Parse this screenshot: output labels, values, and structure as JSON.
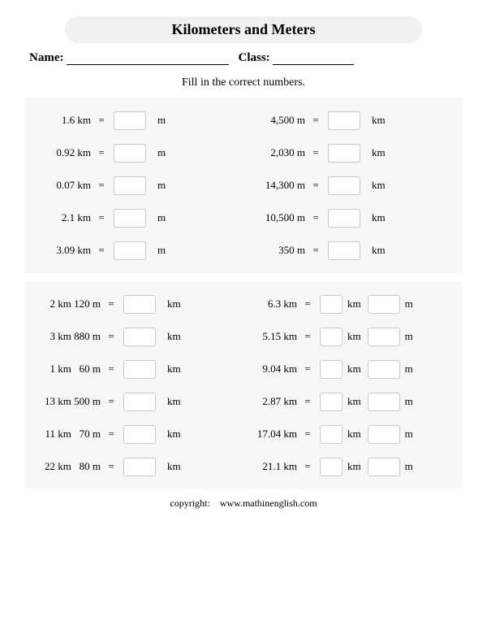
{
  "title": "Kilometers and Meters",
  "header": {
    "name_label": "Name:",
    "class_label": "Class:"
  },
  "instruction": "Fill in the correct numbers.",
  "block1": {
    "left": [
      {
        "v": "1.6 km",
        "u": "m"
      },
      {
        "v": "0.92 km",
        "u": "m"
      },
      {
        "v": "0.07 km",
        "u": "m"
      },
      {
        "v": "2.1 km",
        "u": "m"
      },
      {
        "v": "3.09 km",
        "u": "m"
      }
    ],
    "right": [
      {
        "v": "4,500 m",
        "u": "km"
      },
      {
        "v": "2,030 m",
        "u": "km"
      },
      {
        "v": "14,300 m",
        "u": "km"
      },
      {
        "v": "10,500 m",
        "u": "km"
      },
      {
        "v": "350 m",
        "u": "km"
      }
    ]
  },
  "block2": {
    "left": [
      {
        "v": "2 km 120 m",
        "u": "km"
      },
      {
        "v": "3 km 880 m",
        "u": "km"
      },
      {
        "v": "1 km   60 m",
        "u": "km"
      },
      {
        "v": "13 km 500 m",
        "u": "km"
      },
      {
        "v": "11 km   70 m",
        "u": "km"
      },
      {
        "v": "22 km   80 m",
        "u": "km"
      }
    ],
    "right": [
      {
        "v": "6.3 km",
        "u1": "km",
        "u2": "m"
      },
      {
        "v": "5.15 km",
        "u1": "km",
        "u2": "m"
      },
      {
        "v": "9.04 km",
        "u1": "km",
        "u2": "m"
      },
      {
        "v": "2.87 km",
        "u1": "km",
        "u2": "m"
      },
      {
        "v": "17.04 km",
        "u1": "km",
        "u2": "m"
      },
      {
        "v": "21.1 km",
        "u1": "km",
        "u2": "m"
      }
    ]
  },
  "eq": "=",
  "footer": {
    "label": "copyright:",
    "site": "www.mathinenglish.com"
  }
}
